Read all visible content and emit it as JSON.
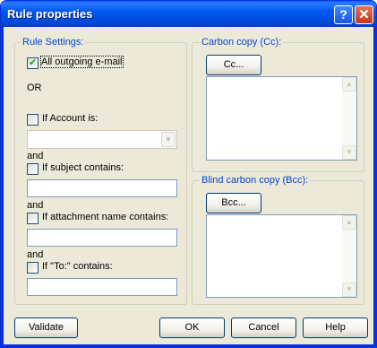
{
  "window": {
    "title": "Rule properties"
  },
  "title_buttons": {
    "help_glyph": "?",
    "close_glyph": "✕"
  },
  "rule_settings": {
    "legend": "Rule Settings:",
    "all_outgoing": {
      "label": "All outgoing e-mail",
      "checked": true
    },
    "or_text": "OR",
    "and_text": "and",
    "if_account": {
      "label": "If Account is:",
      "checked": false,
      "value": ""
    },
    "if_subject": {
      "label": "If subject contains:",
      "checked": false,
      "value": ""
    },
    "if_attachment": {
      "label": "If attachment name contains:",
      "checked": false,
      "value": ""
    },
    "if_to": {
      "label": "If \"To:\" contains:",
      "checked": false,
      "value": ""
    }
  },
  "carbon_copy": {
    "legend": "Carbon copy (Cc):",
    "button": "Cc..."
  },
  "blind_carbon_copy": {
    "legend": "Blind carbon copy (Bcc):",
    "button": "Bcc..."
  },
  "footer": {
    "validate": "Validate",
    "ok": "OK",
    "cancel": "Cancel",
    "help": "Help"
  },
  "icons": {
    "dropdown": "chevron-down-icon",
    "scroll_up": "scroll-up-icon",
    "scroll_down": "scroll-down-icon"
  }
}
